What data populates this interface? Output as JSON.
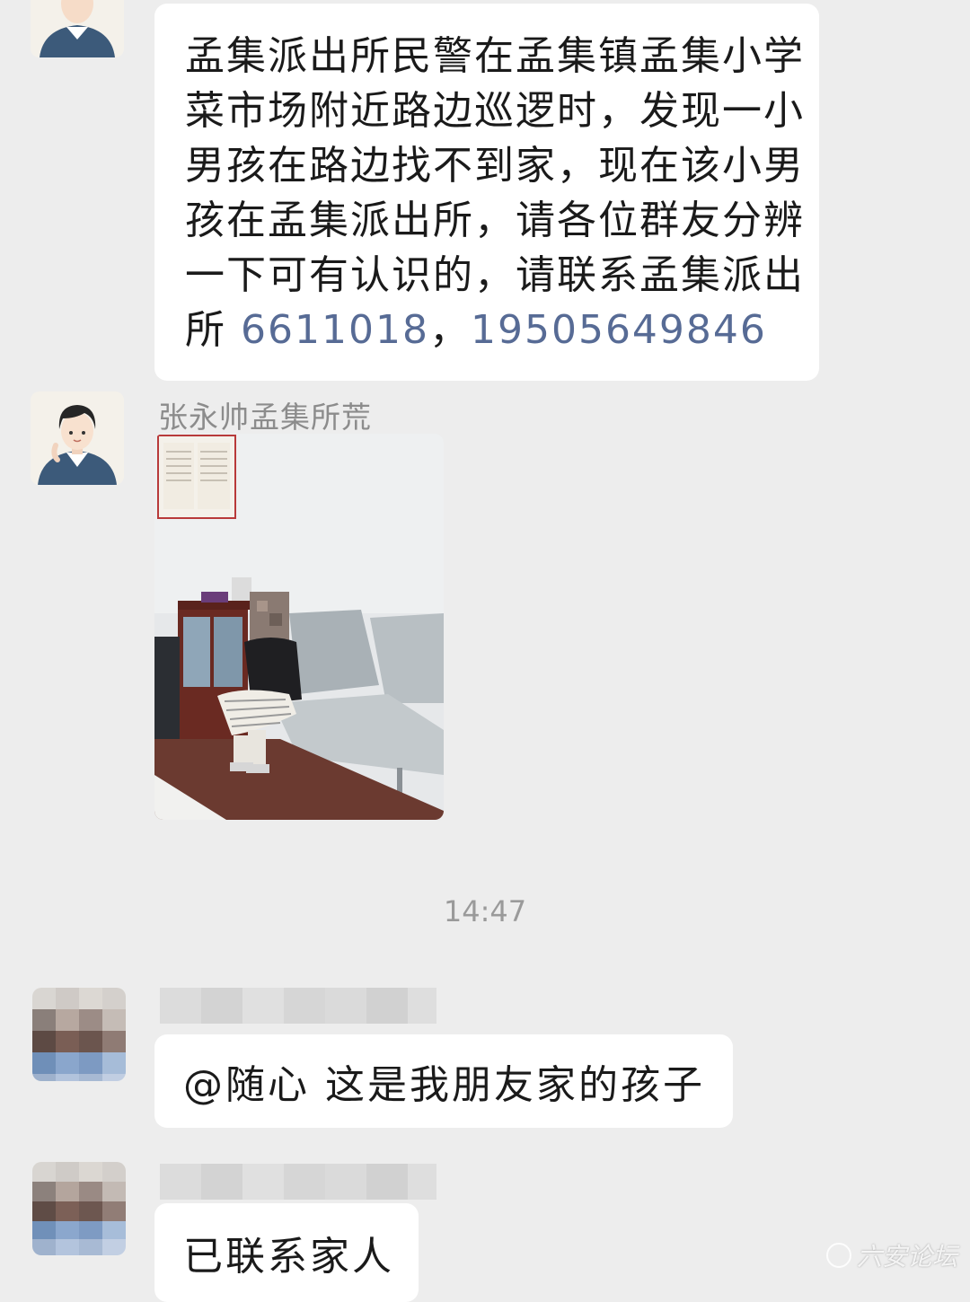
{
  "messages": [
    {
      "type": "text",
      "lines": [
        "孟集派出所民警在孟集镇孟集小学",
        "菜市场附近路边巡逻时，发现一小",
        "男孩在路边找不到家，现在该小男",
        "孩在孟集派出所，请各位群友分辨",
        "一下可有认识的，请联系孟集派出"
      ],
      "last_line_prefix": "所 ",
      "phone_1": "6611018",
      "separator": "，",
      "phone_2": "19505649846"
    },
    {
      "type": "image",
      "sender": "张永帅孟集所荒"
    },
    {
      "type": "text",
      "text": "@随心  这是我朋友家的孩子"
    },
    {
      "type": "text",
      "text": "已联系家人"
    }
  ],
  "timestamp": "14:47",
  "watermark": "六安论坛",
  "colors": {
    "background": "#ededed",
    "bubble": "#ffffff",
    "link": "#576b95",
    "sender_name": "#8c8c8c",
    "timestamp": "#9a9a9a"
  }
}
